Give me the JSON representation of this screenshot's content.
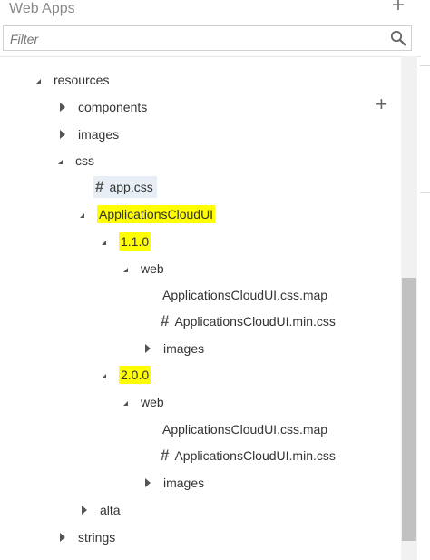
{
  "panel": {
    "title": "Web Apps",
    "add_glyph": "+"
  },
  "filter": {
    "placeholder": "Filter",
    "icon": "search-icon"
  },
  "side_add_glyph": "+",
  "tree": {
    "resources": "resources",
    "components": "components",
    "images_top": "images",
    "css": "css",
    "app_css": "app.css",
    "apps_cloud_ui": "ApplicationsCloudUI",
    "v110": "1.1.0",
    "web_110": "web",
    "map_110": "ApplicationsCloudUI.css.map",
    "min_110": "ApplicationsCloudUI.min.css",
    "images_110": "images",
    "v200": "2.0.0",
    "web_200": "web",
    "map_200": "ApplicationsCloudUI.css.map",
    "min_200": "ApplicationsCloudUI.min.css",
    "images_200": "images",
    "alta": "alta",
    "strings": "strings"
  },
  "colors": {
    "highlight": "#ffff00",
    "selected_bg": "#e8eef6",
    "text": "#333333"
  }
}
